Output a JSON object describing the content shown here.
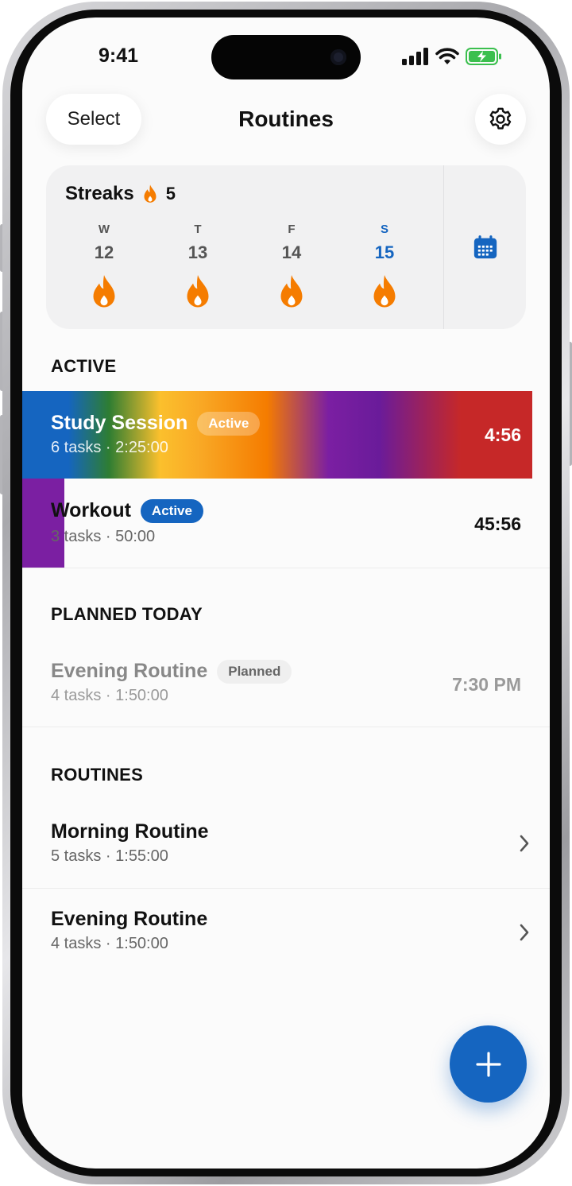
{
  "status_bar": {
    "time": "9:41"
  },
  "nav": {
    "select_label": "Select",
    "title": "Routines"
  },
  "streaks": {
    "title": "Streaks",
    "count": "5",
    "days": [
      {
        "letter": "W",
        "num": "12",
        "today": false
      },
      {
        "letter": "T",
        "num": "13",
        "today": false
      },
      {
        "letter": "F",
        "num": "14",
        "today": false
      },
      {
        "letter": "S",
        "num": "15",
        "today": true
      }
    ]
  },
  "sections": {
    "active": "ACTIVE",
    "planned": "PLANNED TODAY",
    "routines": "ROUTINES"
  },
  "active": [
    {
      "title": "Study Session",
      "badge": "Active",
      "subtitle": "6 tasks · 2:25:00",
      "time": "4:56"
    },
    {
      "title": "Workout",
      "badge": "Active",
      "subtitle": "3 tasks · 50:00",
      "time": "45:56"
    }
  ],
  "planned": [
    {
      "title": "Evening Routine",
      "badge": "Planned",
      "subtitle": "4 tasks · 1:50:00",
      "time": "7:30 PM"
    }
  ],
  "routines": [
    {
      "title": "Morning Routine",
      "subtitle": "5 tasks · 1:55:00"
    },
    {
      "title": "Evening Routine",
      "subtitle": "4 tasks · 1:50:00"
    }
  ],
  "colors": {
    "accent": "#1565c0",
    "flame": "#f57c00",
    "workout": "#7b1fa2"
  }
}
